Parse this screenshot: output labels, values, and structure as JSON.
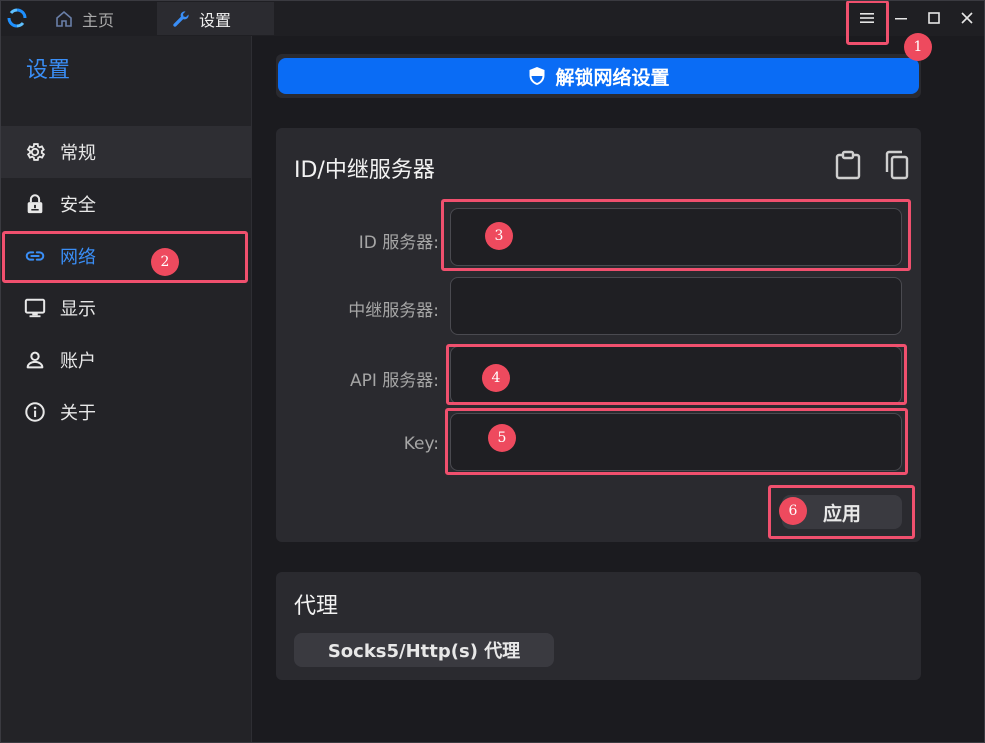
{
  "titlebar": {
    "tabs": [
      {
        "label": "主页",
        "icon": "home-icon"
      },
      {
        "label": "设置",
        "icon": "wrench-icon"
      }
    ]
  },
  "sidebar": {
    "title": "设置",
    "items": [
      {
        "label": "常规",
        "icon": "gear-icon"
      },
      {
        "label": "安全",
        "icon": "lock-icon"
      },
      {
        "label": "网络",
        "icon": "link-icon"
      },
      {
        "label": "显示",
        "icon": "monitor-icon"
      },
      {
        "label": "账户",
        "icon": "user-icon"
      },
      {
        "label": "关于",
        "icon": "info-icon"
      }
    ]
  },
  "main": {
    "unlock_label": "解锁网络设置",
    "id_card": {
      "title": "ID/中继服务器",
      "fields": [
        {
          "label": "ID 服务器:",
          "value": ""
        },
        {
          "label": "中继服务器:",
          "value": ""
        },
        {
          "label": "API 服务器:",
          "value": ""
        },
        {
          "label": "Key:",
          "value": ""
        }
      ],
      "apply_label": "应用"
    },
    "proxy_card": {
      "title": "代理",
      "button_label": "Socks5/Http(s) 代理"
    }
  },
  "annotations": [
    "1",
    "2",
    "3",
    "4",
    "5",
    "6"
  ],
  "colors": {
    "accent": "#0a6cf5",
    "selected": "#3a8ef6",
    "highlight": "#f0506e"
  }
}
